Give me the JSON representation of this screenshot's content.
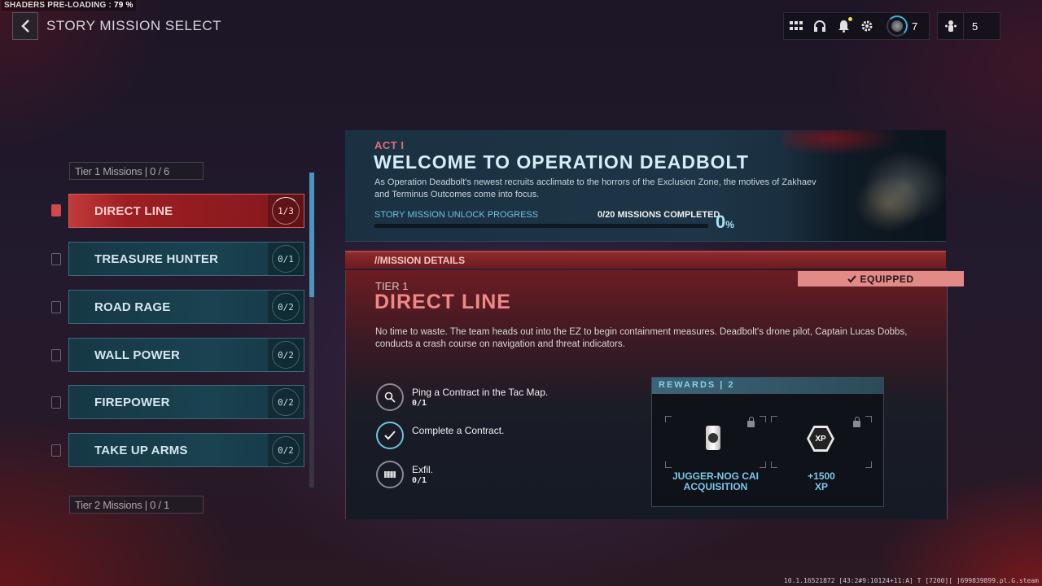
{
  "overlay": {
    "shaders_label": "SHADERS PRE-LOADING :",
    "shaders_value": "79 %"
  },
  "header": {
    "title": "STORY MISSION SELECT",
    "back_icon": "chevron-left-icon",
    "icons": [
      "grid-icon",
      "headset-icon",
      "bell-icon",
      "gear-icon"
    ],
    "notification_dot": true,
    "player_level": "7",
    "party_count": "5"
  },
  "sidebar": {
    "tier1_label": "Tier 1 Missions | 0 / 6",
    "tier2_label": "Tier 2 Missions | 0 / 1",
    "missions": [
      {
        "name": "DIRECT LINE",
        "progress": "1/3",
        "active": true
      },
      {
        "name": "TREASURE HUNTER",
        "progress": "0/1",
        "active": false
      },
      {
        "name": "ROAD RAGE",
        "progress": "0/2",
        "active": false
      },
      {
        "name": "WALL POWER",
        "progress": "0/2",
        "active": false
      },
      {
        "name": "FIREPOWER",
        "progress": "0/2",
        "active": false
      },
      {
        "name": "TAKE UP ARMS",
        "progress": "0/2",
        "active": false
      }
    ]
  },
  "act": {
    "label": "ACT I",
    "title": "WELCOME TO OPERATION DEADBOLT",
    "description": "As Operation Deadbolt's newest recruits acclimate to the horrors of the Exclusion Zone, the motives of Zakhaev and Terminus Outcomes come into focus.",
    "unlock_label": "STORY MISSION UNLOCK PROGRESS",
    "completed_label": "0/20 MISSIONS COMPLETED",
    "percent_value": "0",
    "percent_sign": "%",
    "progress_fraction": 0
  },
  "details": {
    "header": "//MISSION DETAILS",
    "equipped_label": "EQUIPPED",
    "tier": "TIER 1",
    "title": "DIRECT LINE",
    "description": "No time to waste. The team heads out into the EZ to begin containment measures. Deadbolt's drone pilot, Captain Lucas Dobbs, conducts a crash course on navigation and threat indicators.",
    "objectives": [
      {
        "icon": "search-icon",
        "text": "Ping a Contract in the Tac Map.",
        "count": "0/1",
        "done": false
      },
      {
        "icon": "check-icon",
        "text": "Complete a Contract.",
        "count": "",
        "done": true
      },
      {
        "icon": "exfil-icon",
        "text": "Exfil.",
        "count": "0/1",
        "done": false
      }
    ],
    "rewards_label": "REWARDS | 2",
    "rewards": [
      {
        "icon": "soda-can-icon",
        "name_line1": "JUGGER-NOG CAI",
        "name_line2": "ACQUISITION"
      },
      {
        "icon": "xp-icon",
        "name_line1": "+1500",
        "name_line2": "XP",
        "icon_text": "XP"
      }
    ]
  },
  "footer": {
    "build": "10.1.16521872 [43:2#9:10124+11:A] T [7200][ ]699839899.pl.G.steam"
  },
  "colors": {
    "accent_red": "#c23a3a",
    "accent_blue": "#6cc2e0",
    "equipped_bg": "#e28a86"
  }
}
